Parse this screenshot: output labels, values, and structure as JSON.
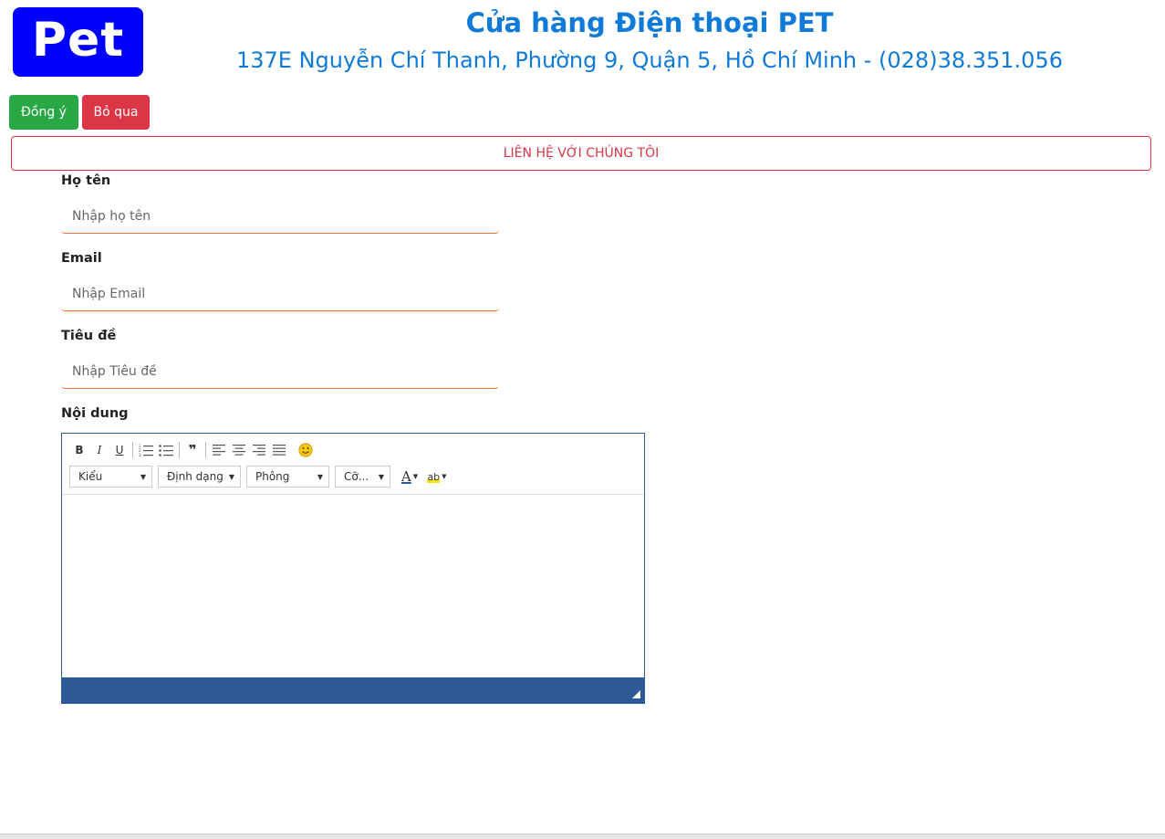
{
  "header": {
    "logo_text": "Pet",
    "title": "Cửa hàng Điện thoại PET",
    "address": "137E Nguyễn Chí Thanh, Phường 9, Quận 5, Hồ Chí Minh - (028)38.351.056"
  },
  "actions": {
    "ok_label": "Đồng ý",
    "skip_label": "Bỏ qua"
  },
  "contact_banner": "LIÊN HỆ VỚI CHÚNG TÔI",
  "form": {
    "name": {
      "label": "Họ tên",
      "placeholder": "Nhập họ tên",
      "value": ""
    },
    "email": {
      "label": "Email",
      "placeholder": "Nhập Email",
      "value": ""
    },
    "subject": {
      "label": "Tiêu đề",
      "placeholder": "Nhập Tiêu đề",
      "value": ""
    },
    "content": {
      "label": "Nội dung"
    }
  },
  "editor": {
    "bold": "B",
    "italic": "I",
    "underline": "U",
    "blockquote": "❞",
    "combos": {
      "style": "Kiểu",
      "format": "Định dạng",
      "font": "Phông",
      "size": "Cỡ..."
    },
    "text_color_glyph": "A",
    "bg_color_glyph": "ab",
    "smiley": "🙂",
    "colors": {
      "border": "#2e5ea0",
      "footer": "#2d5a97"
    }
  },
  "colors": {
    "brand_blue": "#0000ff",
    "title_blue": "#0f7ad8",
    "success": "#28a745",
    "danger": "#dc3545",
    "input_underline": "#e8743b"
  }
}
